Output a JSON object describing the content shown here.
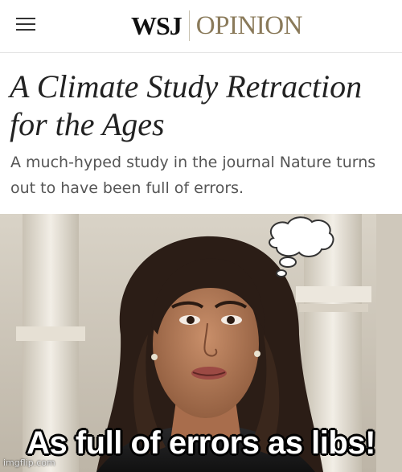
{
  "header": {
    "menu_icon": "hamburger-menu-icon",
    "logo": "WSJ",
    "section": "OPINION",
    "logo_color": "#111111",
    "section_color": "#8a7a5a"
  },
  "article": {
    "headline": "A Climate Study Retraction for the Ages",
    "dek": "A much-hyped study in the journal Nature turns out to have been full of errors."
  },
  "meme": {
    "caption": "As full of errors as libs!",
    "watermark": "imgflip.com"
  }
}
